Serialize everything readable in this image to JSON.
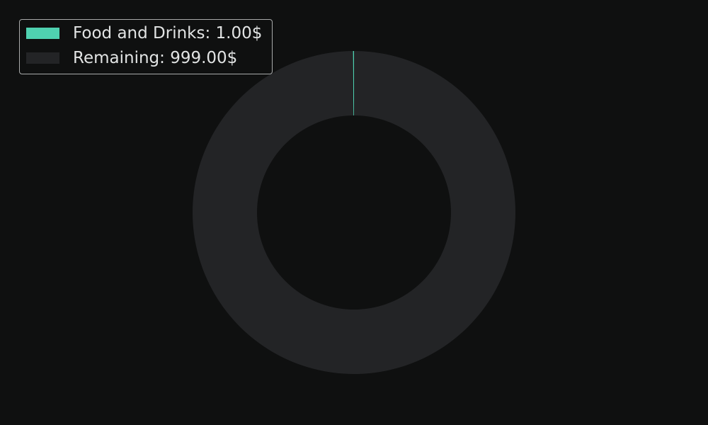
{
  "chart_data": {
    "type": "pie",
    "donut": true,
    "slices": [
      {
        "label": "Food and Drinks: 1.00$",
        "value": 1.0,
        "color": "#4fd1b0"
      },
      {
        "label": "Remaining: 999.00$",
        "value": 999.0,
        "color": "#232426"
      }
    ],
    "legend": {
      "position": "top-left",
      "entries": [
        "Food and Drinks: 1.00$",
        "Remaining: 999.00$"
      ]
    },
    "start_angle": "top",
    "direction": "counterclockwise",
    "background_color": "#0f1010"
  }
}
